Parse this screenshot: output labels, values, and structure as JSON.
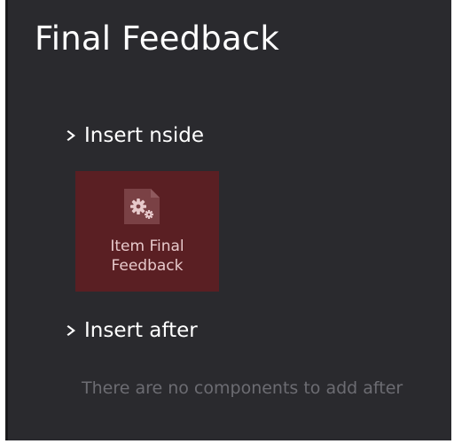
{
  "panel": {
    "title": "Final Feedback",
    "insert_inside": {
      "label": "Insert nside",
      "components": [
        {
          "label": "Item Final Feedback",
          "icon": "gears-document-icon"
        }
      ]
    },
    "insert_after": {
      "label": "Insert after",
      "empty_message": "There are no components to add after"
    }
  },
  "colors": {
    "panel_bg": "#2a2a2e",
    "tile_bg": "#5a1f23",
    "tile_text": "#e7c9cb",
    "muted_text": "#6c6c72"
  }
}
